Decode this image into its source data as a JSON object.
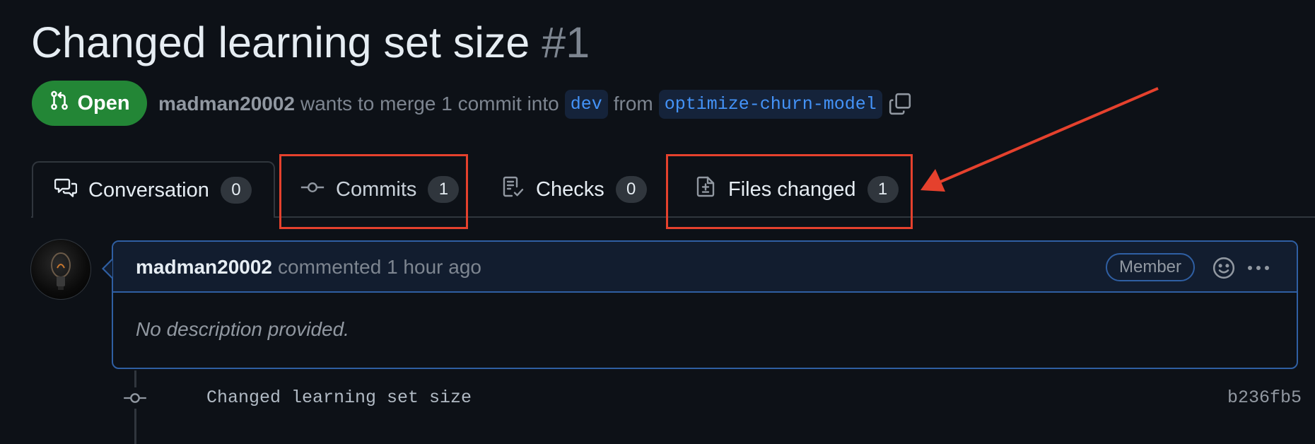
{
  "pull_request": {
    "title": "Changed learning set size",
    "number": "#1",
    "state": "Open",
    "author": "madman20002",
    "merge_text_1": "wants to merge 1 commit into",
    "base_branch": "dev",
    "merge_text_2": "from",
    "head_branch": "optimize-churn-model"
  },
  "tabs": [
    {
      "label": "Conversation",
      "count": "0",
      "icon": "comment-discussion-icon"
    },
    {
      "label": "Commits",
      "count": "1",
      "icon": "git-commit-icon"
    },
    {
      "label": "Checks",
      "count": "0",
      "icon": "checklist-icon"
    },
    {
      "label": "Files changed",
      "count": "1",
      "icon": "file-diff-icon"
    }
  ],
  "comment": {
    "author": "madman20002",
    "action": "commented 1 hour ago",
    "role_badge": "Member",
    "body": "No description provided."
  },
  "commit": {
    "message": "Changed learning set size",
    "sha": "b236fb5"
  },
  "annotation": {
    "color": "#e5412d",
    "highlighted_tabs": [
      "Commits",
      "Files changed"
    ]
  },
  "colors": {
    "background": "#0d1117",
    "open_state": "#238636",
    "link": "#4493f8",
    "comment_border": "#2f5fa3"
  }
}
